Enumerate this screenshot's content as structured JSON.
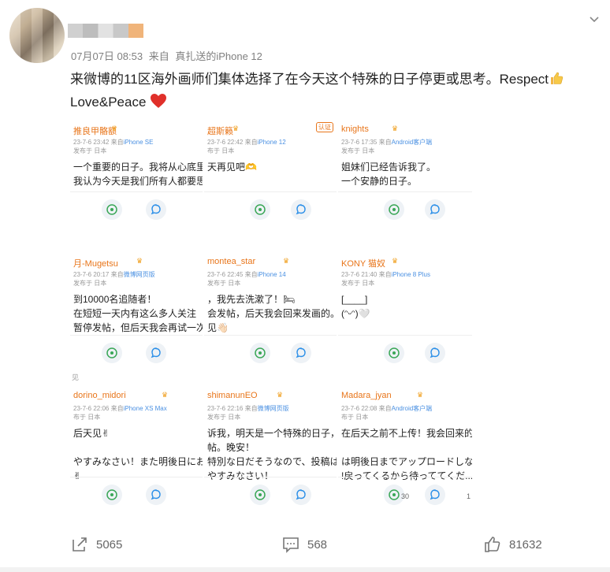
{
  "post": {
    "time": "07月07日 08:53",
    "source_prefix": "来自",
    "source": "真扎送的iPhone 12",
    "text_line1": "来微博的11区海外画师们集体选择了在今天这个特殊的日子停更或思考。Respect",
    "text_line2": "Love&Peace"
  },
  "cards": [
    {
      "name": "推良甲骼额",
      "date": "23-7-6 23:42",
      "src_prefix": "来自",
      "src": "iPhone SE",
      "loc": "发布于 日本",
      "lines": [
        "一个重要的日子。我将从心底里为",
        "我认为今天是我们所有人都要思考"
      ]
    },
    {
      "name": "超斯籁",
      "date": "23-7-6 22:42",
      "src_prefix": "来自",
      "src": "iPhone 12",
      "loc": "布于 日本",
      "lines": [
        "天再见吧🫶"
      ]
    },
    {
      "name": "knights",
      "date": "23-7-6 17:35",
      "src_prefix": "来自",
      "src": "Android客户端",
      "loc": "发布于 日本",
      "lines": [
        "姐妹们已经告诉我了。",
        "一个安静的日子。"
      ]
    },
    {
      "name": "月-Mugetsu",
      "date": "23-7-6 20:17",
      "src_prefix": "来自",
      "src": "微博网页版",
      "loc": "发布于 日本",
      "lines": [
        "到10000名追随者！",
        "在短短一天内有这么多人关注",
        "暂停发帖，但后天我会再试一次"
      ]
    },
    {
      "name": "montea_star",
      "date": "23-7-6 22:45",
      "src_prefix": "来自",
      "src": "iPhone 14",
      "loc": "发布于 日本",
      "lines": [
        "，我先去洗漱了！🛏",
        "会发帖，后天我会回来发画的。",
        "见👋🏻"
      ]
    },
    {
      "name": "KONY 猫奴",
      "date": "23-7-6 21:40",
      "src_prefix": "来自",
      "src": "iPhone 8 Plus",
      "loc": "发布于 日本",
      "lines": [
        "[____]",
        "(ᵔᵕᵔ)🤍"
      ]
    },
    {
      "name": "dorino_midori",
      "date": "23-7-6 22:06",
      "src_prefix": "来自",
      "src": "iPhone XS Max",
      "loc": "布于 日本",
      "lines": [
        "后天见✌",
        "",
        "やすみなさい！また明後日にお",
        "✌"
      ]
    },
    {
      "name": "shimanunEO",
      "date": "23-7-6 22:16",
      "src_prefix": "来自",
      "src": "微博网页版",
      "loc": "发布于 日本",
      "lines": [
        "诉我，明天是一个特殊的日子，所",
        "帖。晚安！",
        "特別な日だそうなので、投稿は控",
        "やすみなさい！"
      ]
    },
    {
      "name": "Madara_jyan",
      "date": "23-7-6 22:08",
      "src_prefix": "来自",
      "src": "Android客户端",
      "loc": "布于 日本",
      "lines": [
        "在后天之前不上传！我会回来的，",
        "",
        "は明後日までアップロードしない",
        "!戻ってくるから待っててくだ..."
      ]
    }
  ],
  "card_extra": {
    "badge": "认证",
    "see_label": "见",
    "comments": "30",
    "likes": "1"
  },
  "actions": {
    "repost": "5065",
    "comment": "568",
    "like": "81632"
  },
  "colors": {
    "accent_orange": "#e8751a",
    "link_blue": "#4a90e2",
    "heart_red": "#e0302a"
  }
}
